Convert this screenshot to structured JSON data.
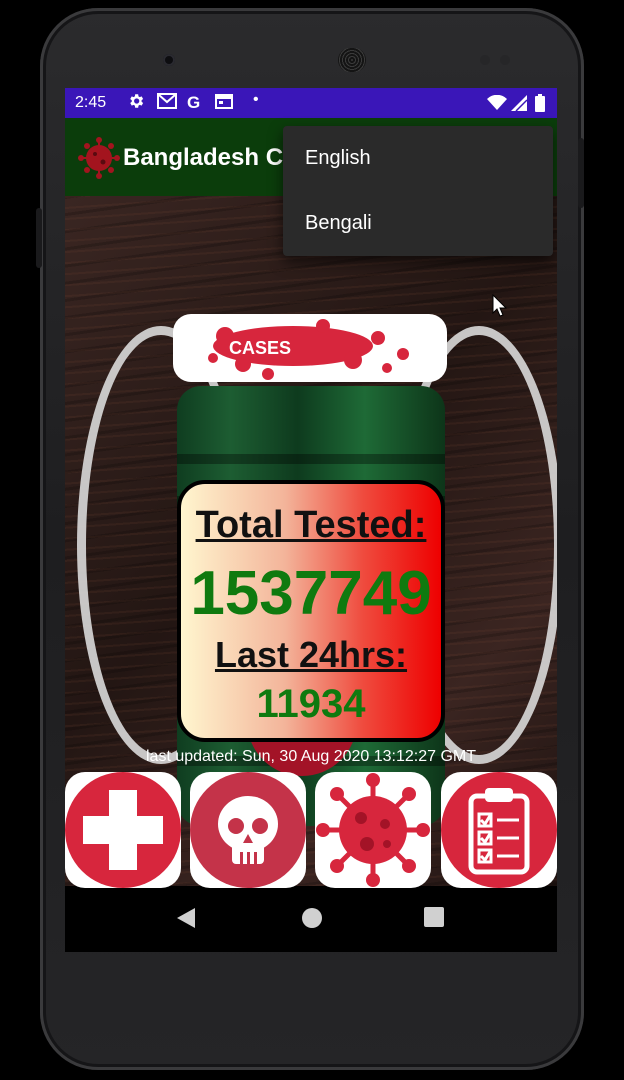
{
  "status_bar": {
    "time": "2:45",
    "icons": [
      "settings-icon",
      "gmail-icon",
      "google-icon",
      "calendar-icon",
      "dot-icon",
      "wifi-icon",
      "signal-icon",
      "battery-icon"
    ],
    "color": "#3a16b8"
  },
  "app_bar": {
    "title": "Bangladesh C",
    "color": "#0b3d0b"
  },
  "menu": {
    "items": [
      {
        "label": "English"
      },
      {
        "label": "Bengali"
      }
    ]
  },
  "cases_button": {
    "label": "CASES"
  },
  "stats": {
    "total_label": "Total Tested:",
    "total_value": "1537749",
    "last24_label": "Last 24hrs:",
    "last24_value": "11934"
  },
  "last_updated": "last updated: Sun, 30 Aug 2020 13:12:27 GMT",
  "bottom_tiles": [
    {
      "icon": "medical-cross-icon"
    },
    {
      "icon": "skull-icon"
    },
    {
      "icon": "virus-icon"
    },
    {
      "icon": "clipboard-checklist-icon"
    }
  ],
  "colors": {
    "accent_red": "#d7263d",
    "value_green": "#0f7a0f"
  }
}
